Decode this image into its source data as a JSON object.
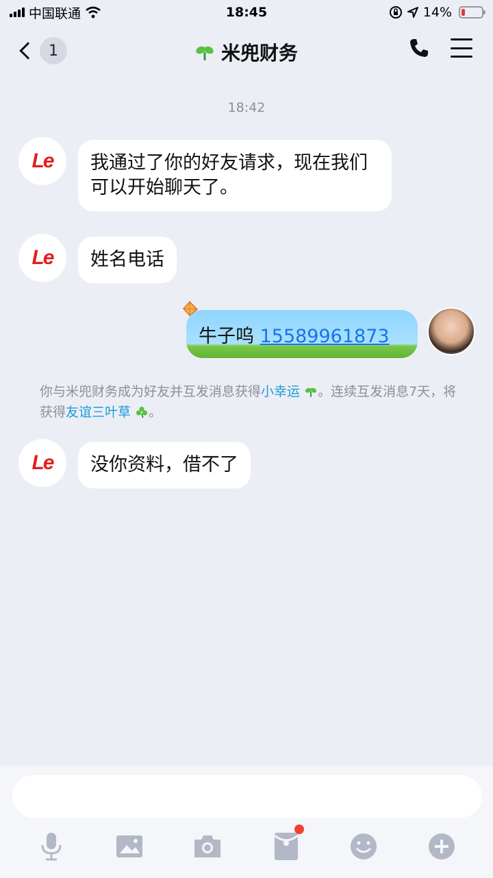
{
  "status_bar": {
    "carrier": "中国联通",
    "time": "18:45",
    "battery": "14%",
    "battery_level": 0.14
  },
  "nav": {
    "unread_count": "1",
    "title": "米兜财务"
  },
  "timestamp": "18:42",
  "messages": [
    {
      "sender": "Le",
      "text": "我通过了你的好友请求，现在我们可以开始聊天了。"
    },
    {
      "sender": "Le",
      "text": "姓名电话"
    },
    {
      "sender": "me",
      "text_prefix": "牛子呜 ",
      "phone": "15589961873"
    },
    {
      "sender": "Le",
      "text": "没你资料，借不了"
    }
  ],
  "system_note": {
    "part1": "你与米兜财务成为好友并互发消息获得",
    "link1": "小幸运",
    "part2": "。连续互发消息7天，将获得",
    "link2": "友谊三叶草",
    "part3": "。"
  },
  "avatar_logo": "Le",
  "icons": [
    "signal-icon",
    "wifi-icon",
    "lock-rotation-icon",
    "location-icon",
    "battery-icon",
    "back-chevron-icon",
    "sprout-icon",
    "phone-icon",
    "menu-icon",
    "kite-icon",
    "clover-icon",
    "mic-icon",
    "image-icon",
    "camera-icon",
    "red-packet-icon",
    "emoji-icon",
    "plus-icon"
  ],
  "colors": {
    "background": "#eceef6",
    "link": "#1d9bd6",
    "phone_link": "#1a73e8",
    "logo_red": "#e02020",
    "toolbar_icon": "#b3b8c6",
    "notify_dot": "#f0422e"
  }
}
